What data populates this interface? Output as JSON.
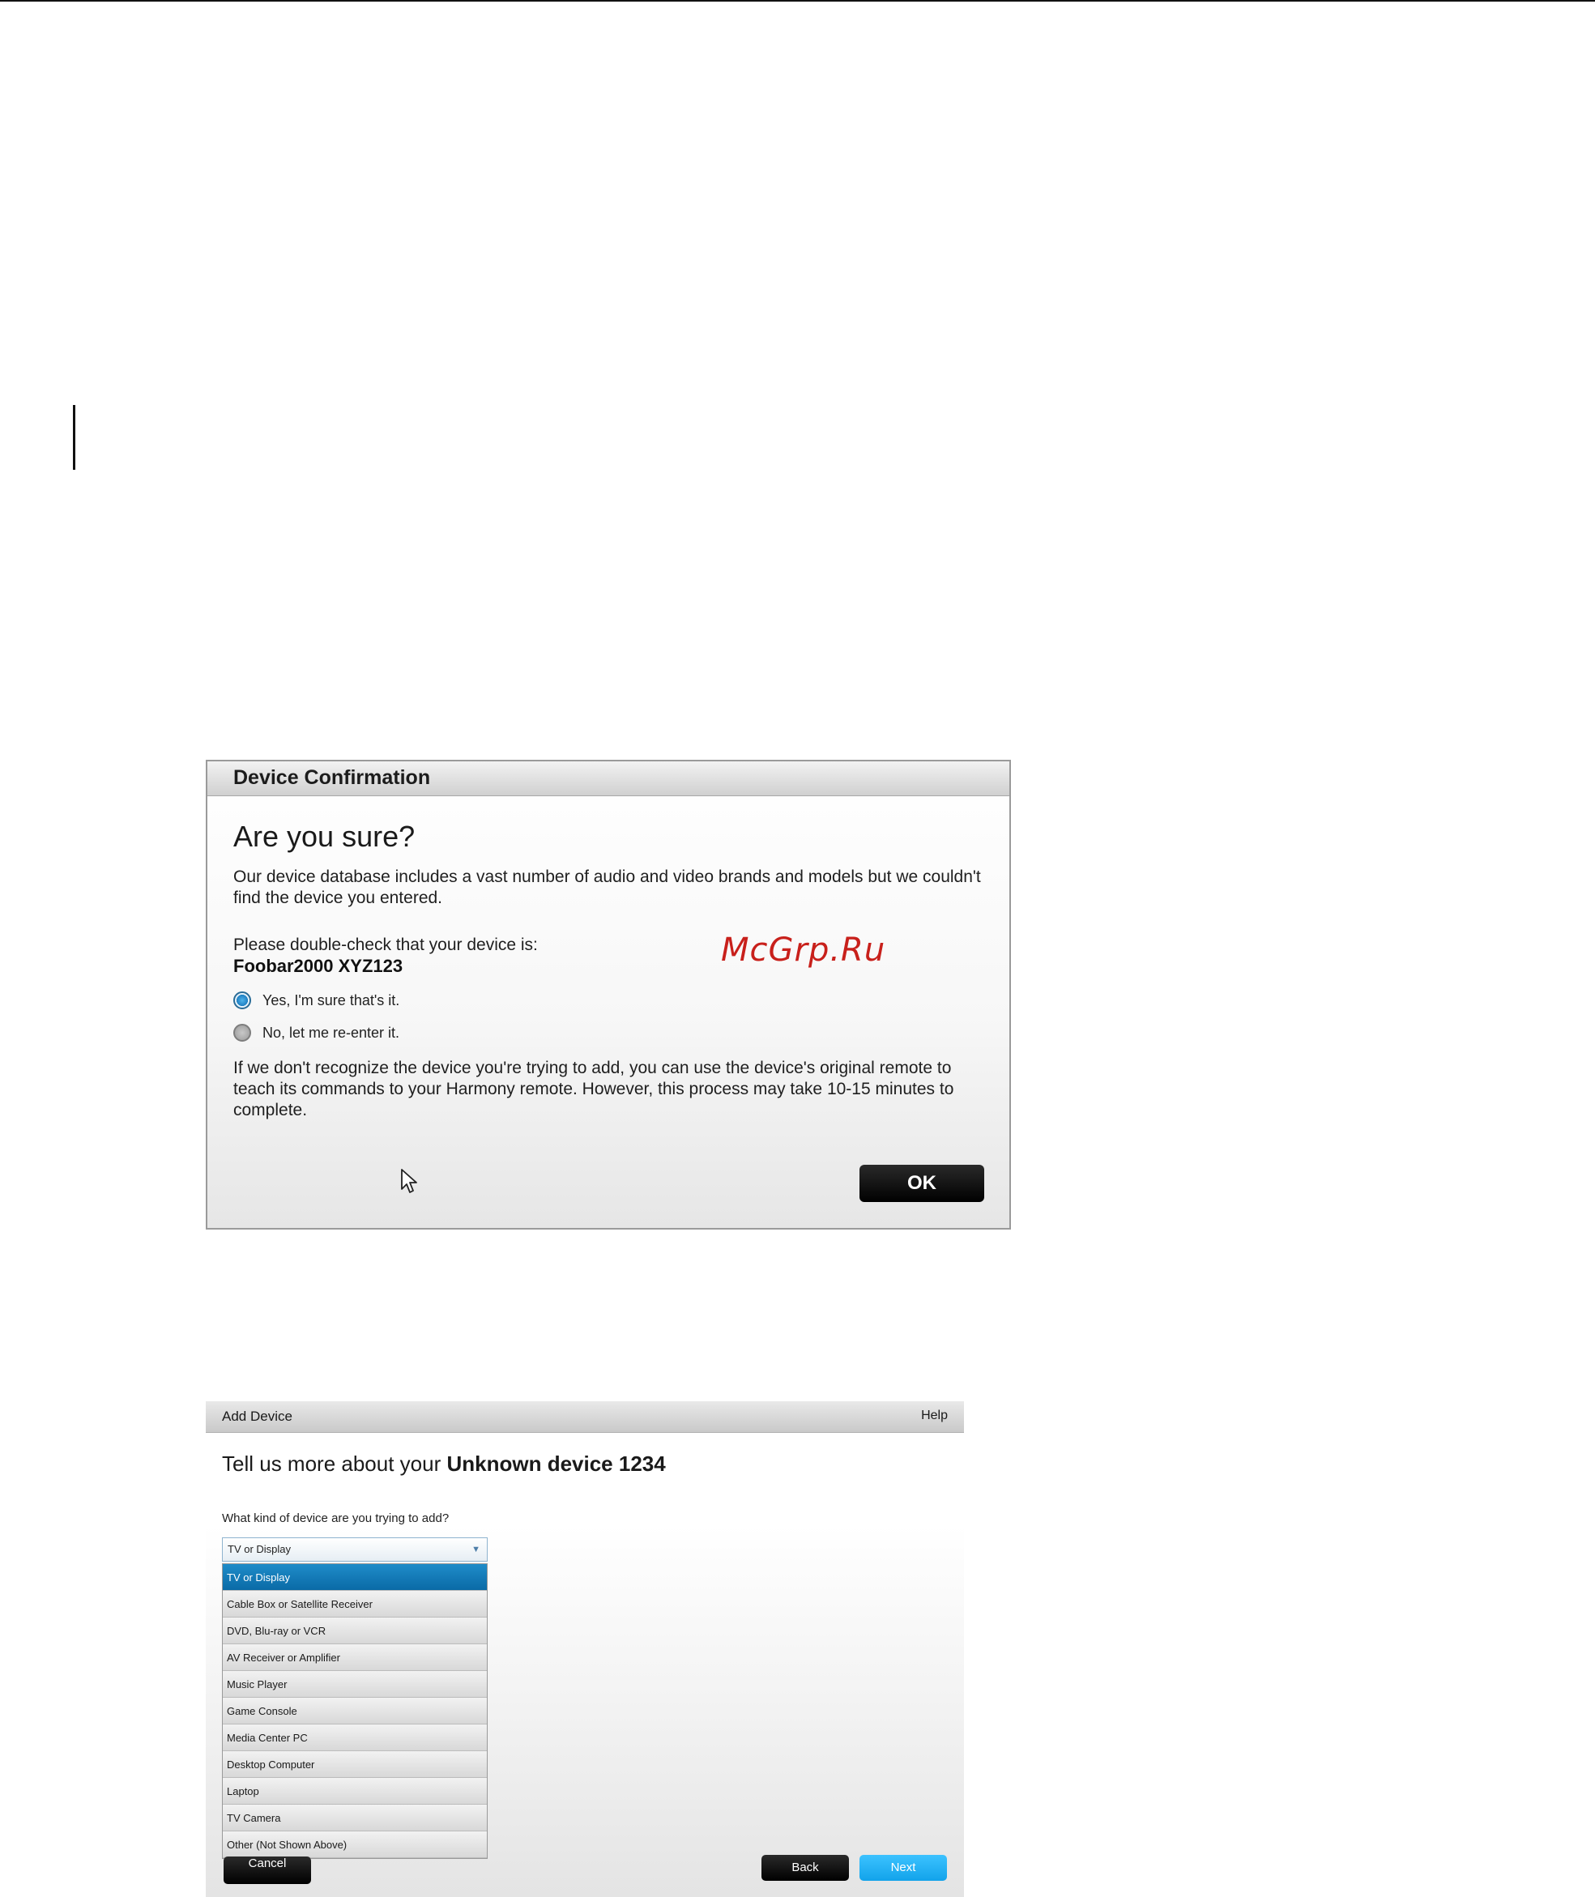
{
  "confirmation_dialog": {
    "header": "Device Confirmation",
    "title": "Are you sure?",
    "intro": "Our device database includes a vast number of audio and video brands and models but we couldn't find the device you entered.",
    "check_prompt": "Please double-check that your device is:",
    "device_name": "Foobar2000 XYZ123",
    "options": [
      {
        "label": "Yes, I'm sure that's it.",
        "selected": true
      },
      {
        "label": "No, let me re-enter it.",
        "selected": false
      }
    ],
    "note": "If we don't recognize the device you're trying to add, you can use the device's original remote to teach its commands to your Harmony remote. However, this process may take 10-15 minutes to complete.",
    "ok_label": "OK"
  },
  "watermark": "McGrp.Ru",
  "add_device": {
    "header": "Add Device",
    "help_label": "Help",
    "title_prefix": "Tell us more about your",
    "title_device": "Unknown device 1234",
    "question": "What kind of device are you trying to add?",
    "selected_value": "TV or Display",
    "options": [
      "TV or Display",
      "Cable Box or Satellite Receiver",
      "DVD, Blu-ray or VCR",
      "AV Receiver or Amplifier",
      "Music Player",
      "Game Console",
      "Media Center PC",
      "Desktop Computer",
      "Laptop",
      "TV Camera",
      "Other (Not Shown Above)"
    ],
    "cancel_label": "Cancel",
    "back_label": "Back",
    "next_label": "Next"
  }
}
